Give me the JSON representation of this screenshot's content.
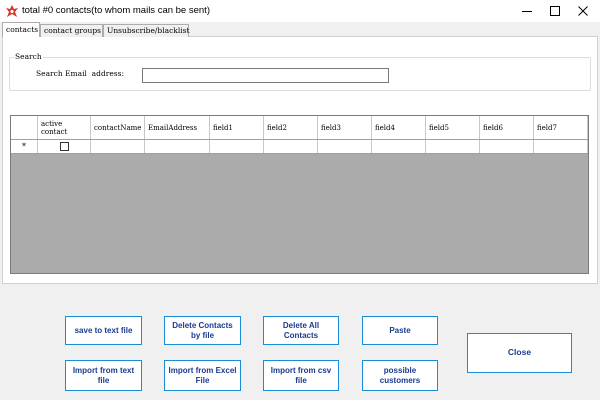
{
  "window": {
    "title": "total #0 contacts(to whom mails can be sent)"
  },
  "tabs": [
    {
      "label": "contacts",
      "active": true
    },
    {
      "label": "contact groups",
      "active": false
    },
    {
      "label": "Unsubscribe/blacklist",
      "active": false
    }
  ],
  "search": {
    "group_title": "Search",
    "label": "Search Email  address:",
    "value": ""
  },
  "grid": {
    "columns": [
      {
        "label": ""
      },
      {
        "label": "active contact"
      },
      {
        "label": "contactName"
      },
      {
        "label": "EmailAddress"
      },
      {
        "label": "field1"
      },
      {
        "label": "field2"
      },
      {
        "label": "field3"
      },
      {
        "label": "field4"
      },
      {
        "label": "field5"
      },
      {
        "label": "field6"
      },
      {
        "label": "field7"
      }
    ],
    "new_row_marker": "*"
  },
  "buttons": {
    "save_text": "save to text file",
    "delete_by_file": "Delete Contacts by file",
    "delete_all": "Delete All Contacts",
    "paste": "Paste",
    "import_text": "Import from text file",
    "import_excel": "Import from Excel File",
    "import_csv": "Import from csv file",
    "possible_customers": "possible customers",
    "close": "Close"
  },
  "colors": {
    "button_border": "#1a8dd8",
    "button_text": "#1a3b8f",
    "grid_empty_area": "#ababab",
    "app_icon": "#d9342b"
  }
}
